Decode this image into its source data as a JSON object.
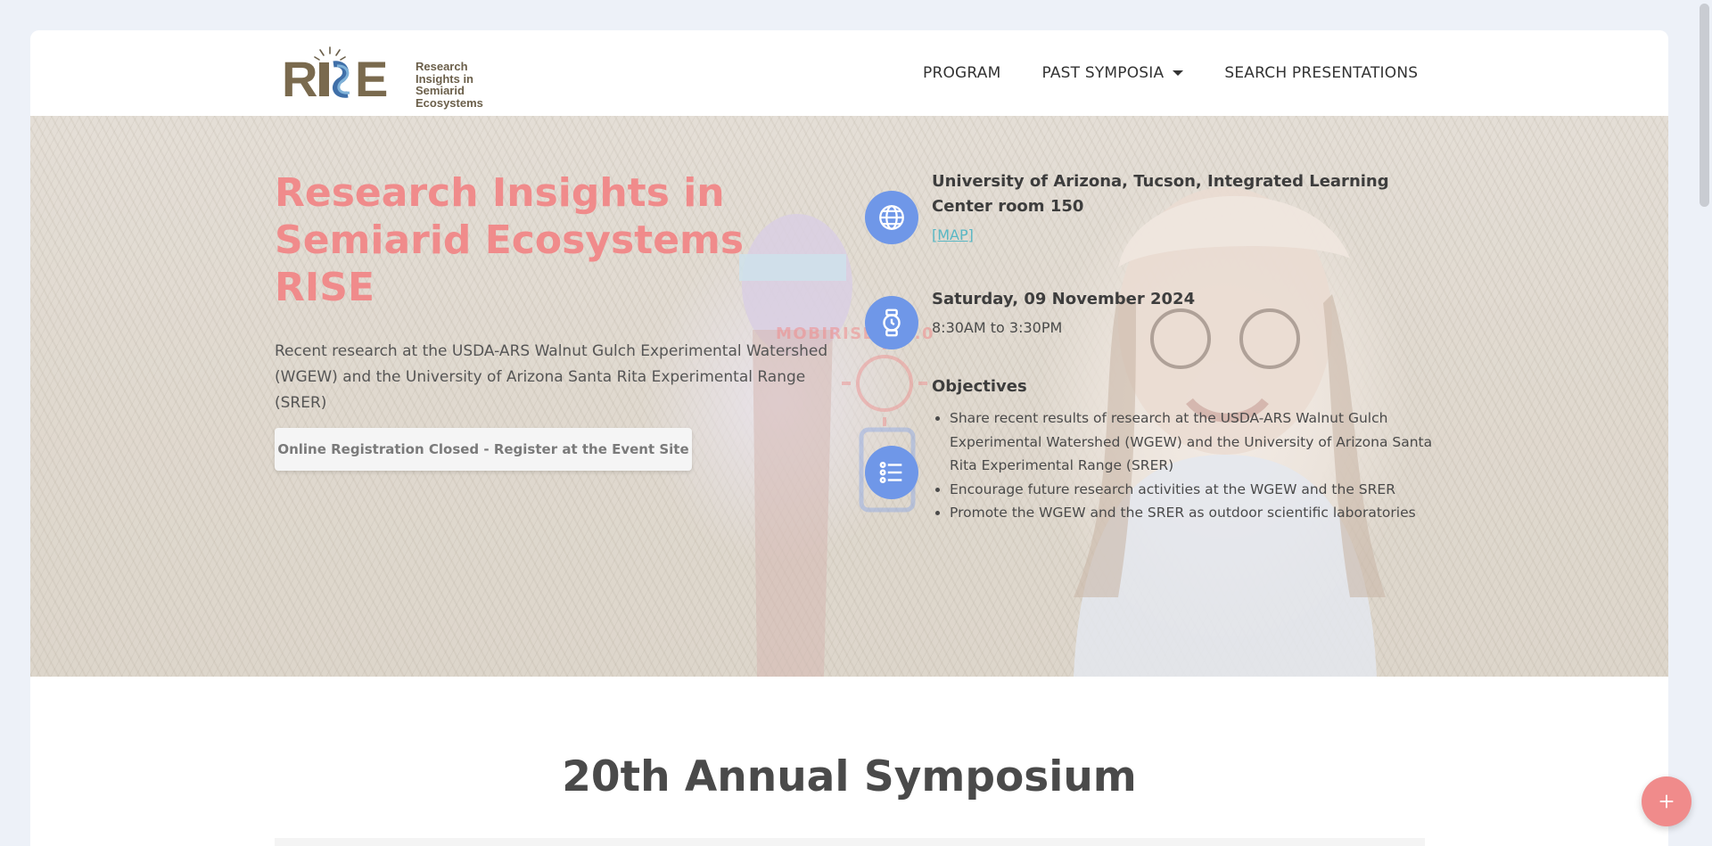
{
  "colors": {
    "accent": "#f08b8b",
    "icon_circle": "#6f97e8",
    "map_link": "#59b7c4",
    "page_bg": "#edf1f8"
  },
  "header": {
    "logo": {
      "wordmark": "RISE",
      "subtitle_lines": [
        "Research",
        "Insights in",
        "Semiarid",
        "Ecosystems"
      ]
    },
    "nav": [
      {
        "label": "PROGRAM",
        "has_dropdown": false
      },
      {
        "label": "PAST SYMPOSIA",
        "has_dropdown": true
      },
      {
        "label": "SEARCH PRESENTATIONS",
        "has_dropdown": false
      }
    ]
  },
  "hero": {
    "title_lines": [
      "Research Insights in",
      "Semiarid Ecosystems",
      "RISE"
    ],
    "description": "Recent research at the USDA-ARS Walnut Gulch Experimental Watershed (WGEW) and the University of Arizona Santa Rita Experimental Range (SRER)",
    "button_label": "Online Registration Closed - Register at the Event Site",
    "watermark": "MOBIRISE 5.9.0",
    "location": {
      "icon": "globe-icon",
      "title": "University of Arizona, Tucson, Integrated Learning Center room 150",
      "map_label": "[MAP]"
    },
    "date": {
      "icon": "watch-icon",
      "title": "Saturday, 09 November 2024",
      "time": "8:30AM to 3:30PM"
    },
    "objectives": {
      "icon": "list-icon",
      "title": "Objectives",
      "items": [
        "Share recent results of research at the USDA-ARS Walnut Gulch Experimental Watershed (WGEW) and the University of Arizona Santa Rita Experimental Range (SRER)",
        "Encourage future research activities at the WGEW and the SRER",
        "Promote the WGEW and the SRER as outdoor scientific laboratories"
      ]
    }
  },
  "section": {
    "title": "20th Annual Symposium"
  },
  "fab": {
    "icon": "plus-icon"
  }
}
